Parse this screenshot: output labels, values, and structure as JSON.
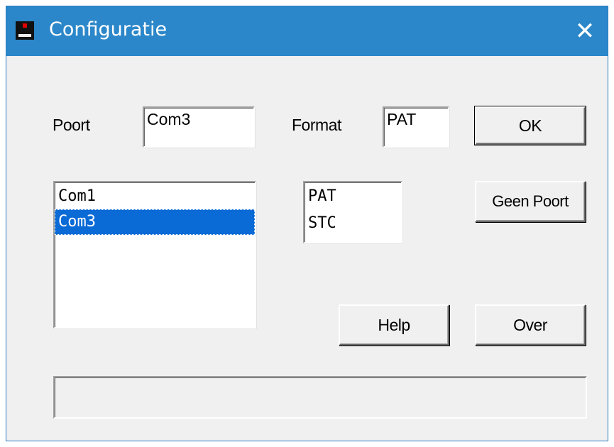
{
  "window": {
    "title": "Configuratie",
    "close_glyph": "✕",
    "app_icon": "app-icon",
    "colors": {
      "titlebar": "#2b87c9",
      "face": "#f0f0f0",
      "selection": "#0a6ad6"
    }
  },
  "poort": {
    "label": "Poort",
    "value": "Com3"
  },
  "format": {
    "label": "Format",
    "value": "PAT"
  },
  "port_list": {
    "items": [
      "Com1",
      "Com3"
    ],
    "selected": "Com3"
  },
  "format_list": {
    "items": [
      "PAT",
      "STC"
    ]
  },
  "buttons": {
    "ok": "OK",
    "geen_poort": "Geen Poort",
    "help": "Help",
    "over": "Over"
  },
  "status": {
    "text": ""
  }
}
